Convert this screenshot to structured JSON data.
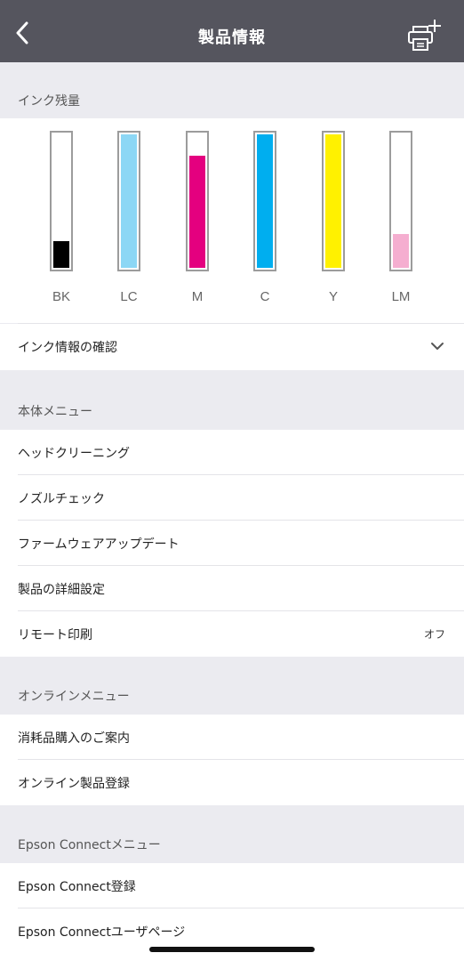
{
  "header": {
    "title": "製品情報",
    "back_icon": "chevron-left-icon",
    "add_printer_icon": "add-printer-icon"
  },
  "ink_section": {
    "title": "インク残量",
    "tanks": [
      {
        "label": "BK",
        "level": 0.2,
        "color": "#000000"
      },
      {
        "label": "LC",
        "level": 1.0,
        "color": "#8cd7f5"
      },
      {
        "label": "M",
        "level": 0.84,
        "color": "#e4007f"
      },
      {
        "label": "C",
        "level": 1.0,
        "color": "#00aeef"
      },
      {
        "label": "Y",
        "level": 1.0,
        "color": "#fff100"
      },
      {
        "label": "LM",
        "level": 0.25,
        "color": "#f5aed0"
      }
    ],
    "info_label": "インク情報の確認"
  },
  "device_menu": {
    "title": "本体メニュー",
    "items": [
      {
        "label": "ヘッドクリーニング"
      },
      {
        "label": "ノズルチェック"
      },
      {
        "label": "ファームウェアアップデート"
      },
      {
        "label": "製品の詳細設定"
      },
      {
        "label": "リモート印刷",
        "value": "オフ"
      }
    ]
  },
  "online_menu": {
    "title": "オンラインメニュー",
    "items": [
      {
        "label": "消耗品購入のご案内"
      },
      {
        "label": "オンライン製品登録"
      }
    ]
  },
  "epson_connect_menu": {
    "title": "Epson Connectメニュー",
    "items": [
      {
        "label": "Epson Connect登録"
      },
      {
        "label": "Epson Connectユーザページ"
      }
    ]
  }
}
